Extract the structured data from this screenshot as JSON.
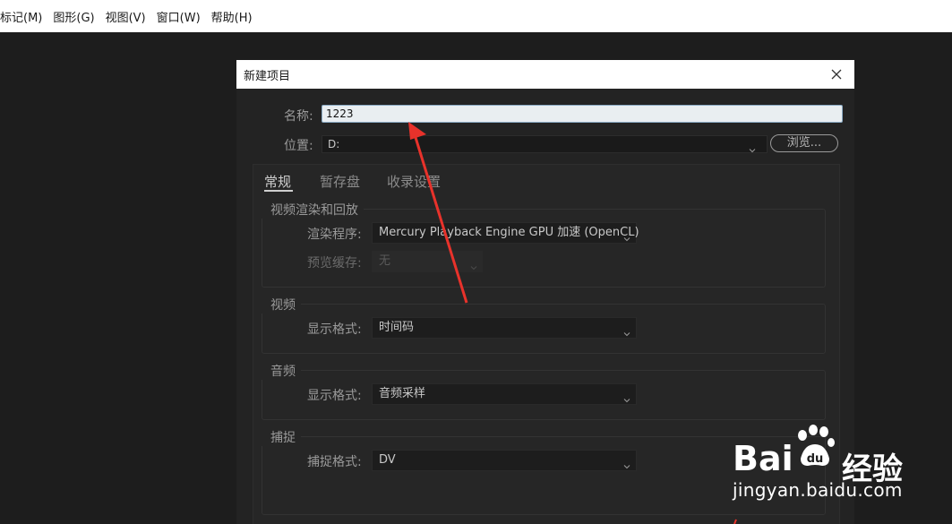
{
  "menubar": {
    "items": [
      "标记(M)",
      "图形(G)",
      "视图(V)",
      "窗口(W)",
      "帮助(H)"
    ]
  },
  "dialog": {
    "title": "新建项目",
    "name_label": "名称:",
    "name_value": "1223",
    "location_label": "位置:",
    "location_value": "D:",
    "browse_label": "浏览...",
    "tabs": [
      "常规",
      "暂存盘",
      "收录设置"
    ],
    "groups": {
      "video_render": {
        "title": "视频渲染和回放",
        "renderer_label": "渲染程序:",
        "renderer_value": "Mercury Playback Engine GPU 加速 (OpenCL)",
        "preview_cache_label": "预览缓存:",
        "preview_cache_value": "无"
      },
      "video": {
        "title": "视频",
        "display_format_label": "显示格式:",
        "display_format_value": "时间码"
      },
      "audio": {
        "title": "音频",
        "display_format_label": "显示格式:",
        "display_format_value": "音频采样"
      },
      "capture": {
        "title": "捕捉",
        "capture_format_label": "捕捉格式:",
        "capture_format_value": "DV"
      }
    }
  },
  "watermark": {
    "brand": "Bai",
    "brand_cn": "经验",
    "url": "jingyan.baidu.com"
  },
  "colors": {
    "annotation_arrow": "#e8322b",
    "input_border": "#8aaac4"
  }
}
